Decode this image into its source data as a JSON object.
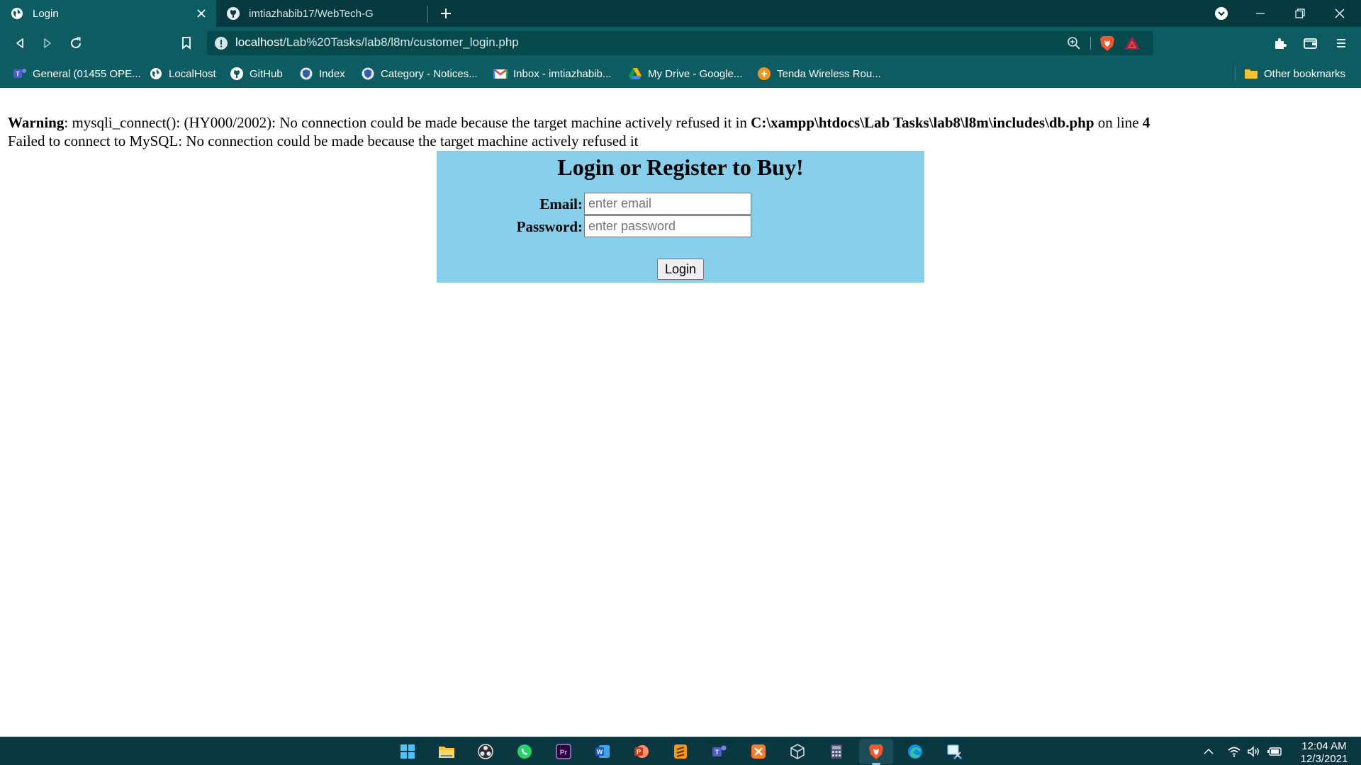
{
  "tabs": [
    {
      "title": "Login",
      "active": true,
      "icon": "globe-icon"
    },
    {
      "title": "imtiazhabib17/WebTech-G",
      "active": false,
      "icon": "github-icon"
    }
  ],
  "address_bar": {
    "host": "localhost",
    "path": "/Lab%20Tasks/lab8/l8m/customer_login.php"
  },
  "bookmarks": [
    {
      "label": "General (01455 OPE...",
      "icon": "teams-icon"
    },
    {
      "label": "LocalHost",
      "icon": "globe-icon"
    },
    {
      "label": "GitHub",
      "icon": "github-icon"
    },
    {
      "label": "Index",
      "icon": "shield-icon"
    },
    {
      "label": "Category - Notices...",
      "icon": "shield-icon"
    },
    {
      "label": "Inbox - imtiazhabib...",
      "icon": "gmail-icon"
    },
    {
      "label": "My Drive - Google...",
      "icon": "google-drive-icon"
    },
    {
      "label": "Tenda Wireless Rou...",
      "icon": "router-icon"
    }
  ],
  "other_bookmarks": "Other bookmarks",
  "page": {
    "warning": {
      "prefix": "Warning",
      "message": ": mysqli_connect(): (HY000/2002): No connection could be made because the target machine actively refused it in ",
      "file": "C:\\xampp\\htdocs\\Lab Tasks\\lab8\\l8m\\includes\\db.php",
      "on_line": " on line ",
      "line": "4"
    },
    "failure": "Failed to connect to MySQL: No connection could be made because the target machine actively refused it",
    "form": {
      "title": "Login or Register to Buy!",
      "email_label": "Email:",
      "email_placeholder": "enter email",
      "password_label": "Password:",
      "password_placeholder": "enter password",
      "submit_label": "Login",
      "background": "#87ceeb"
    }
  },
  "taskbar": {
    "apps": [
      "start-icon",
      "file-explorer-icon",
      "obs-icon",
      "whatsapp-icon",
      "premiere-icon",
      "word-icon",
      "powerpoint-icon",
      "sublime-icon",
      "teams-icon",
      "xampp-icon",
      "virtualbox-icon",
      "calculator-icon",
      "brave-icon",
      "edge-icon",
      "snipping-tool-icon"
    ],
    "clock_time": "12:04 AM",
    "clock_date": "12/3/2021"
  },
  "colors": {
    "tabstrip": "#063a3e",
    "toolbar": "#0c5c61",
    "taskbar": "#0b3741"
  }
}
